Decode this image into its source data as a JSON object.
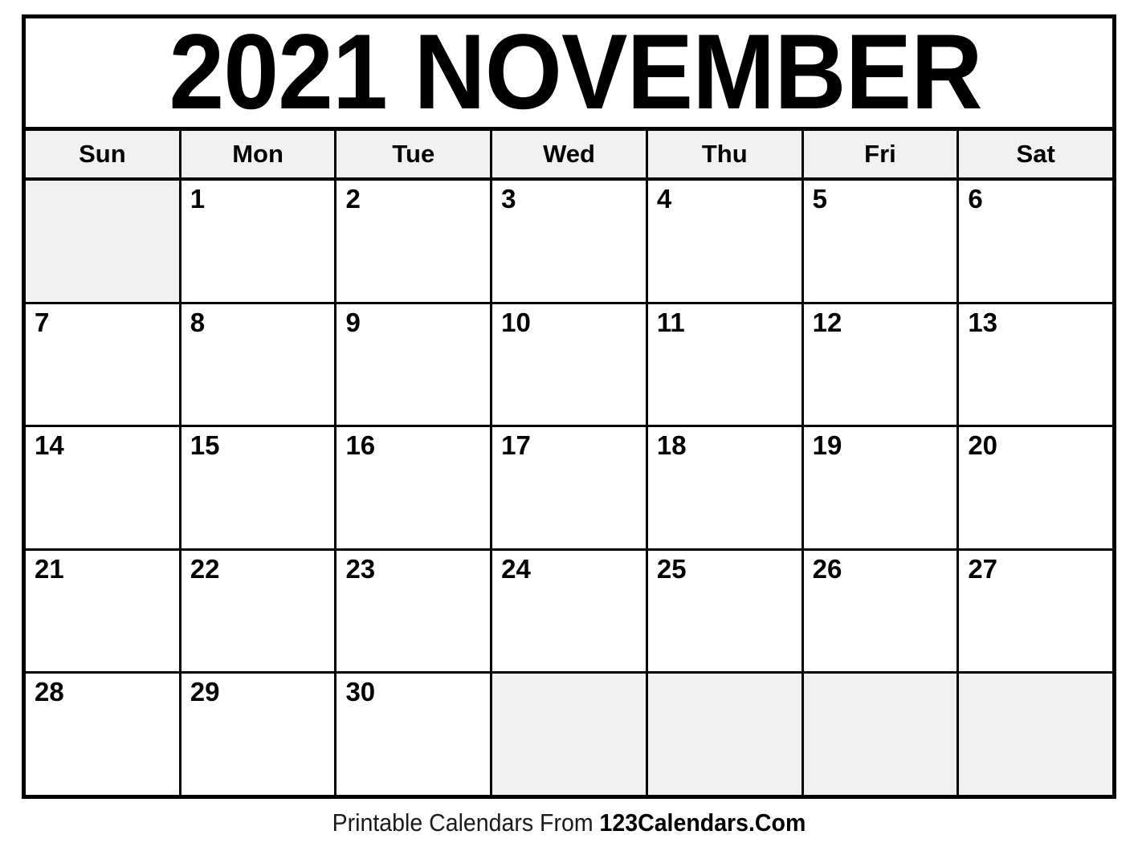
{
  "document": {
    "type": "printable-monthly-calendar",
    "title": "2021 NOVEMBER",
    "year": "2021",
    "month": "NOVEMBER"
  },
  "weekday_headers": [
    {
      "label": "Sun"
    },
    {
      "label": "Mon"
    },
    {
      "label": "Tue"
    },
    {
      "label": "Wed"
    },
    {
      "label": "Thu"
    },
    {
      "label": "Fri"
    },
    {
      "label": "Sat"
    }
  ],
  "weeks": [
    {
      "days": [
        {
          "number": "",
          "blank": true
        },
        {
          "number": "1",
          "blank": false
        },
        {
          "number": "2",
          "blank": false
        },
        {
          "number": "3",
          "blank": false
        },
        {
          "number": "4",
          "blank": false
        },
        {
          "number": "5",
          "blank": false
        },
        {
          "number": "6",
          "blank": false
        }
      ]
    },
    {
      "days": [
        {
          "number": "7",
          "blank": false
        },
        {
          "number": "8",
          "blank": false
        },
        {
          "number": "9",
          "blank": false
        },
        {
          "number": "10",
          "blank": false
        },
        {
          "number": "11",
          "blank": false
        },
        {
          "number": "12",
          "blank": false
        },
        {
          "number": "13",
          "blank": false
        }
      ]
    },
    {
      "days": [
        {
          "number": "14",
          "blank": false
        },
        {
          "number": "15",
          "blank": false
        },
        {
          "number": "16",
          "blank": false
        },
        {
          "number": "17",
          "blank": false
        },
        {
          "number": "18",
          "blank": false
        },
        {
          "number": "19",
          "blank": false
        },
        {
          "number": "20",
          "blank": false
        }
      ]
    },
    {
      "days": [
        {
          "number": "21",
          "blank": false
        },
        {
          "number": "22",
          "blank": false
        },
        {
          "number": "23",
          "blank": false
        },
        {
          "number": "24",
          "blank": false
        },
        {
          "number": "25",
          "blank": false
        },
        {
          "number": "26",
          "blank": false
        },
        {
          "number": "27",
          "blank": false
        }
      ]
    },
    {
      "days": [
        {
          "number": "28",
          "blank": false
        },
        {
          "number": "29",
          "blank": false
        },
        {
          "number": "30",
          "blank": false
        },
        {
          "number": "",
          "blank": true
        },
        {
          "number": "",
          "blank": true
        },
        {
          "number": "",
          "blank": true
        },
        {
          "number": "",
          "blank": true
        }
      ]
    }
  ],
  "footer": {
    "prefix": "Printable Calendars From ",
    "brand": "123Calendars.Com"
  },
  "colors": {
    "border": "#000000",
    "text": "#000000",
    "blank_cell_background": "#f1f1f1",
    "header_row_background": "#f1f1f1",
    "page_background": "#ffffff"
  }
}
